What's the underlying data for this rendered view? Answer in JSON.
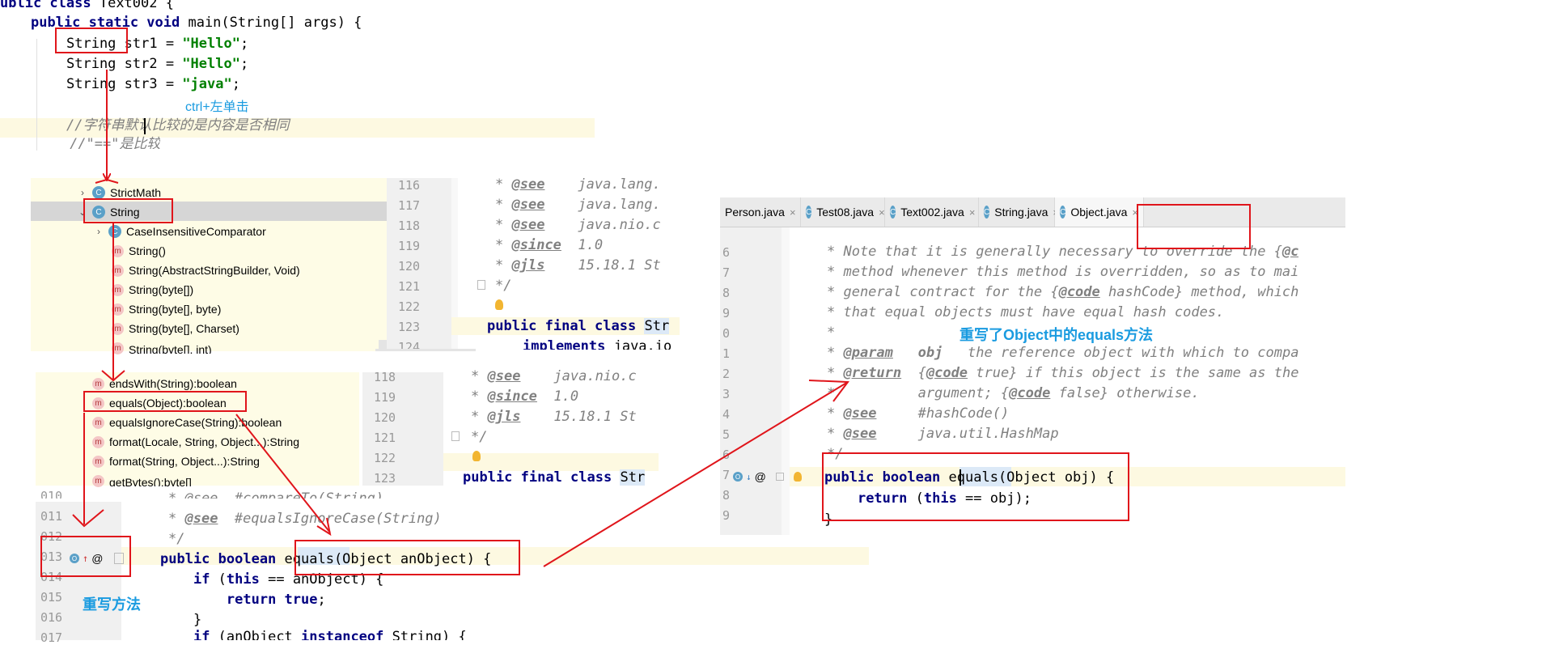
{
  "top_code": {
    "line0": "ublic class Text002 {",
    "line1": "public static void main(String[] args) {",
    "line2_type": "String",
    "line2_rest": " str1 = ",
    "line2_str": "\"Hello\"",
    "line3_rest": "String str2 = ",
    "line3_str": "\"Hello\"",
    "line4_rest": "String str3 = ",
    "line4_str": "\"java\"",
    "comment1": "//字符串默认比较的是内容是否相同",
    "comment2": "//\"==\"是比较"
  },
  "annotations": {
    "ctrl_click": "ctrl+左单击",
    "override_method": "重写方法",
    "override_object_equals": "重写了Object中的equals方法"
  },
  "structure_panel_1": {
    "rows": [
      {
        "label": "StrictMath",
        "icon": "class-icon",
        "chevron": "›"
      },
      {
        "label": "String",
        "icon": "class-icon",
        "chevron": "⌄"
      },
      {
        "label": "CaseInsensitiveComparator",
        "icon": "class-icon",
        "chevron": "›"
      },
      {
        "label": "String()",
        "icon": "m"
      },
      {
        "label": "String(AbstractStringBuilder, Void)",
        "icon": "m"
      },
      {
        "label": "String(byte[])",
        "icon": "m"
      },
      {
        "label": "String(byte[], byte)",
        "icon": "m"
      },
      {
        "label": "String(byte[], Charset)",
        "icon": "m"
      },
      {
        "label": "String(byte[], int)",
        "icon": "m"
      }
    ],
    "line_numbers": [
      "116",
      "117",
      "118",
      "119",
      "120",
      "121",
      "122",
      "123",
      "124"
    ],
    "code": [
      {
        "tag": "@see",
        "text": "java.lang."
      },
      {
        "tag": "@see",
        "text": "java.lang."
      },
      {
        "tag": "@see",
        "text": "java.nio.c"
      },
      {
        "tag": "@since",
        "text": "1.0"
      },
      {
        "tag": "@jls",
        "text": "15.18.1 St"
      },
      {
        "tag": "",
        "text": "*/"
      },
      {
        "tag": "",
        "text": ""
      },
      {
        "tag": "",
        "text": "public final class Str"
      },
      {
        "tag": "",
        "text": "implements java.io"
      }
    ]
  },
  "structure_panel_2": {
    "rows": [
      {
        "label": "endsWith(String):boolean"
      },
      {
        "label": "equals(Object):boolean"
      },
      {
        "label": "equalsIgnoreCase(String):boolean"
      },
      {
        "label": "format(Locale, String, Object...):String"
      },
      {
        "label": "format(String, Object...):String"
      },
      {
        "label": "getBytes():byte[]"
      }
    ],
    "line_numbers": [
      "118",
      "119",
      "120",
      "121",
      "122",
      "123"
    ],
    "code": [
      {
        "tag": "@see",
        "text": "java.nio.c"
      },
      {
        "tag": "@since",
        "text": "1.0"
      },
      {
        "tag": "@jls",
        "text": "15.18.1 St"
      },
      {
        "tag": "",
        "text": "*/"
      },
      {
        "tag": "",
        "text": ""
      },
      {
        "tag": "",
        "text": "public final class Str"
      }
    ]
  },
  "string_equals_panel": {
    "line_numbers": [
      "010",
      "011",
      "012",
      "013",
      "014",
      "015",
      "016",
      "017"
    ],
    "lines": [
      "* @see  #compareTo(String)",
      "* @see  #equalsIgnoreCase(String)",
      "*/",
      "public boolean equals(Object anObject) {",
      "    if (this == anObject) {",
      "        return true;",
      "    }",
      "    if (anObject instanceof String) {"
    ],
    "gutter_at": "@"
  },
  "object_panel": {
    "tabs": [
      {
        "label": "Person.java",
        "icon": ""
      },
      {
        "label": "Test08.java",
        "icon": "C"
      },
      {
        "label": "Text002.java",
        "icon": "C"
      },
      {
        "label": "String.java",
        "icon": "C"
      },
      {
        "label": "Object.java",
        "icon": "C"
      }
    ],
    "line_numbers": [
      "6",
      "7",
      "8",
      "9",
      "0",
      "1",
      "2",
      "3",
      "4",
      "5",
      "6",
      "7",
      "8",
      "9"
    ],
    "comments": [
      "* Note that it is generally necessary to override the {@c",
      "* method whenever this method is overridden, so as to mai",
      "* general contract for the {@code hashCode} method, which",
      "* that equal objects must have equal hash codes.",
      "*",
      "* @param   obj   the reference object with which to compa",
      "* @return  {@code true} if this object is the same as the",
      "*          argument; {@code false} otherwise.",
      "* @see     #hashCode()",
      "* @see     java.util.HashMap",
      "*/"
    ],
    "method_sig": "public boolean equals(Object obj) {",
    "method_body": "    return (this == obj);",
    "method_end": "}",
    "gutter_at": "@"
  }
}
